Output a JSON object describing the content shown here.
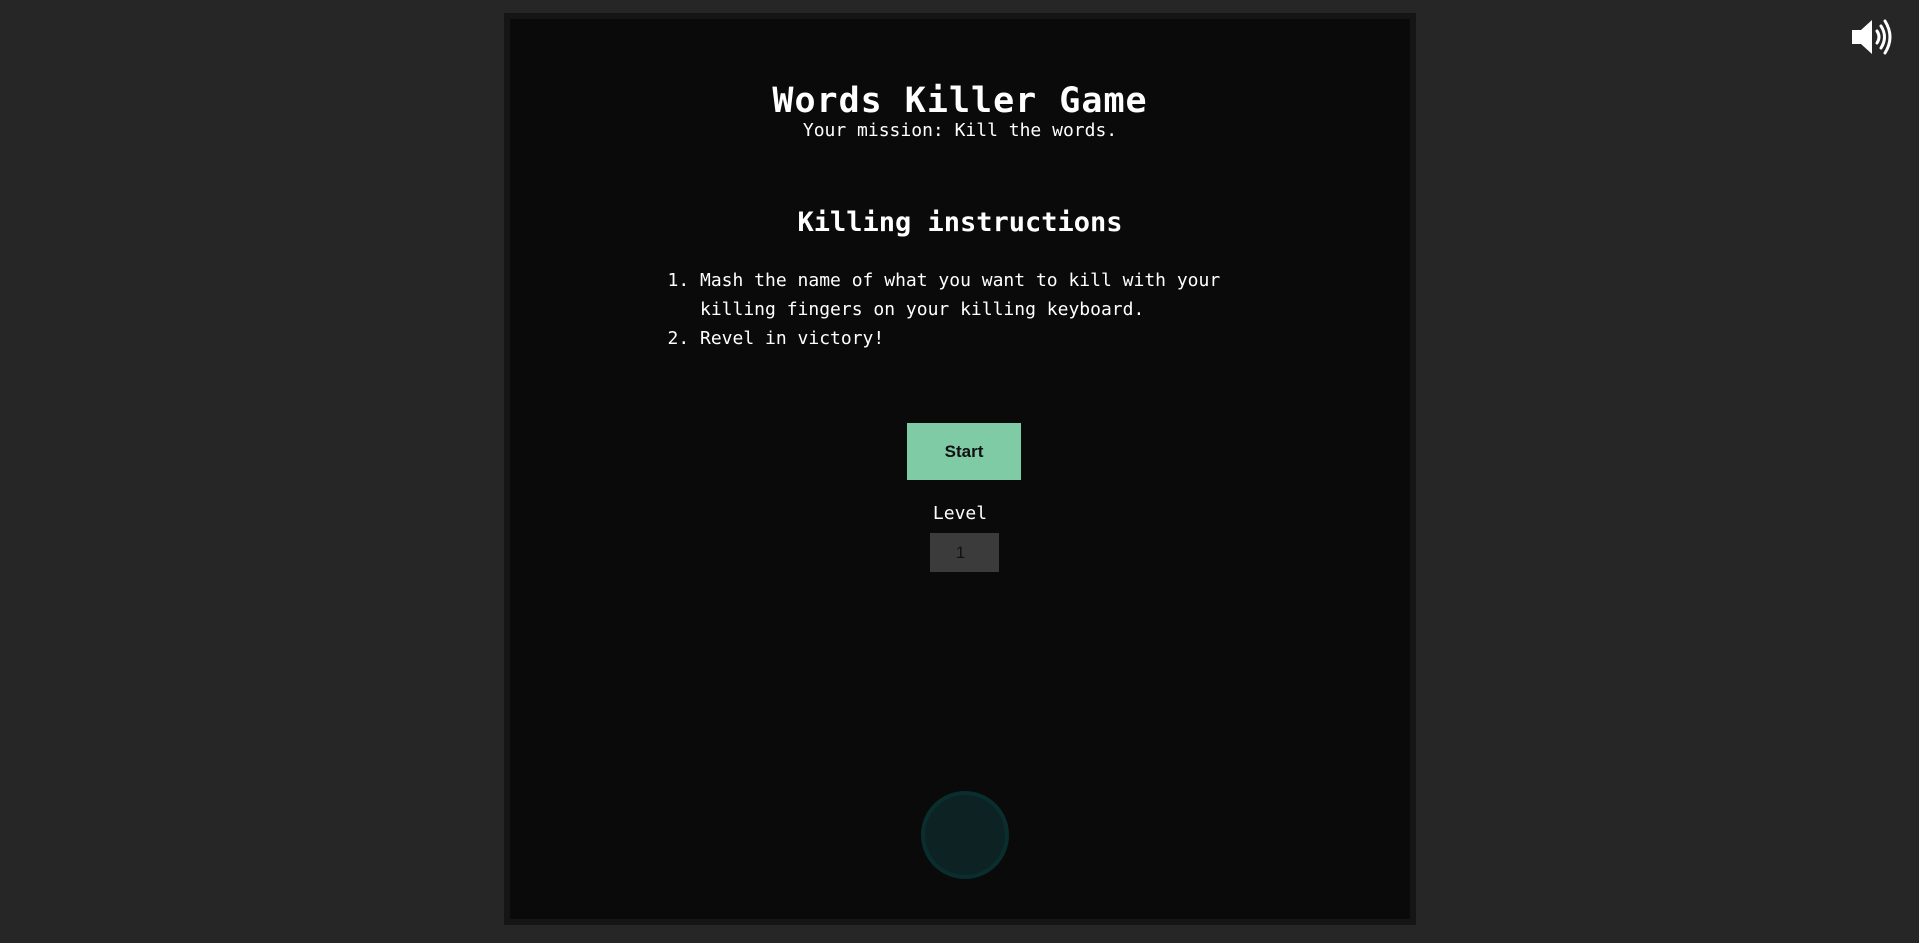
{
  "game": {
    "title": "Words Killer Game",
    "subtitle": "Your mission: Kill the words.",
    "instructions": {
      "heading": "Killing instructions",
      "steps": [
        "Mash the name of what you want to kill with your killing fingers on your killing keyboard.",
        "Revel in victory!"
      ]
    },
    "start_label": "Start",
    "level": {
      "label": "Level",
      "value": "1"
    },
    "sound_icon": "speaker-volume-icon",
    "player_icon": "player-circle-icon"
  },
  "colors": {
    "page_background": "#262626",
    "stage_background": "#0a0a0a",
    "stage_border": "#151515",
    "start_button": "#7ecba6",
    "level_input": "#3b3b3b",
    "player": "#0d2222",
    "text": "#ffffff"
  }
}
